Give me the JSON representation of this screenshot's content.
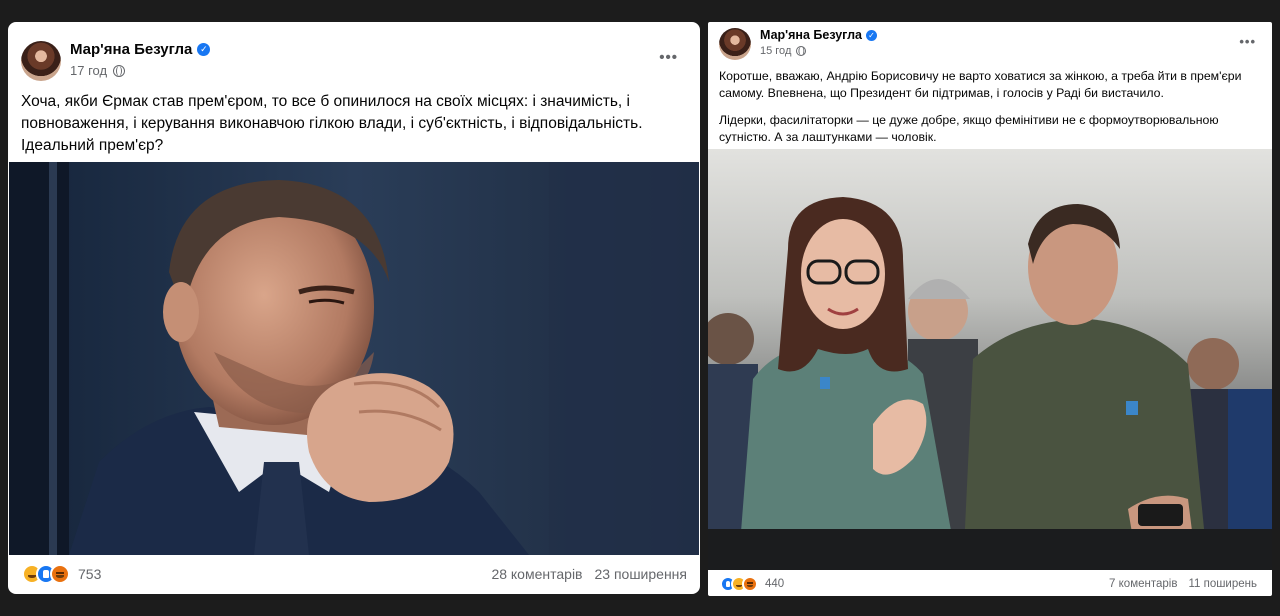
{
  "left_post": {
    "author": "Мар'яна Безугла",
    "time": "17 год",
    "verified_mark": "✓",
    "more_button": "•••",
    "text": "Хоча, якби Єрмак став прем'єром, то все б опинилося на своїх місцях: і значимість, і повноваження, і керування виконавчою гілкою влади, і суб'єктність, і відповідальність. Ідеальний прем'єр?",
    "reaction_icons": [
      "haha-icon",
      "like-icon",
      "angry-icon"
    ],
    "reactions_count": "753",
    "comments": "28 коментарів",
    "shares": "23 поширення"
  },
  "right_post": {
    "author": "Мар'яна Безугла",
    "time": "15 год",
    "verified_mark": "✓",
    "more_button": "•••",
    "paragraph1": "Коротше, вважаю, Андрію Борисовичу не варто ховатися за жінкою, а треба йти в прем'єри самому. Впевнена, що Президент би підтримав, і голосів у Раді би вистачило.",
    "paragraph2": "Лідерки, фасилітаторки — це дуже добре, якщо фемінітиви не є формоутворювальною сутністю. А за лаштунками — чоловік.",
    "reaction_icons": [
      "like-icon",
      "haha-icon",
      "angry-icon"
    ],
    "reactions_count": "440",
    "comments": "7 коментарів",
    "shares": "11 поширень"
  },
  "colors": {
    "page_bg": "#1c1c1c",
    "card_bg": "#ffffff",
    "text_primary": "#050505",
    "text_secondary": "#65676b",
    "verified_blue": "#1877f2"
  }
}
